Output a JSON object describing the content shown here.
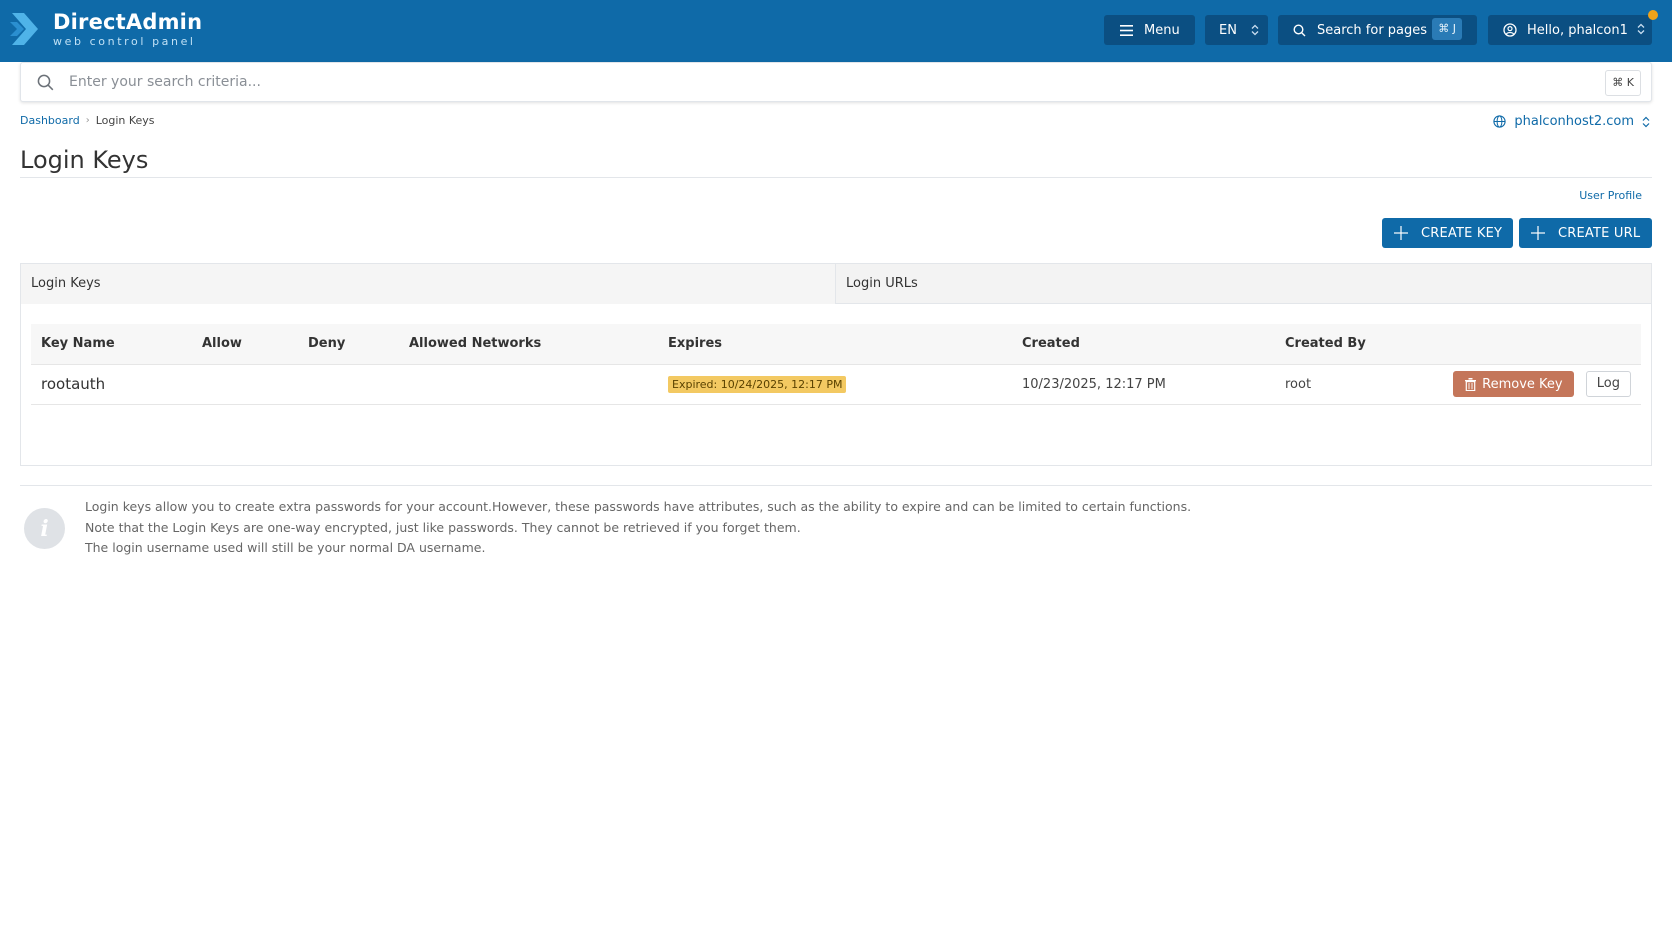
{
  "header": {
    "brand_title": "DirectAdmin",
    "brand_subtitle": "web control panel",
    "menu_label": "Menu",
    "language": "EN",
    "search_pages_label": "Search for pages",
    "search_pages_shortcut": "⌘ J",
    "user_greeting": "Hello, phalcon1",
    "brand_color": "#0f6aa8",
    "notification_color": "#f0a31a"
  },
  "search": {
    "placeholder": "Enter your search criteria...",
    "shortcut": "⌘ K"
  },
  "breadcrumb": {
    "items": [
      "Dashboard",
      "Login Keys"
    ]
  },
  "domain_selector": "phalconhost2.com",
  "page": {
    "title": "Login Keys",
    "user_profile_link": "User Profile",
    "create_key_label": "CREATE KEY",
    "create_url_label": "CREATE URL"
  },
  "tabs": [
    {
      "label": "Login Keys",
      "active": true
    },
    {
      "label": "Login URLs",
      "active": false
    }
  ],
  "table": {
    "columns": [
      "Key Name",
      "Allow",
      "Deny",
      "Allowed Networks",
      "Expires",
      "Created",
      "Created By"
    ],
    "rows": [
      {
        "key_name": "rootauth",
        "allow": "",
        "deny": "",
        "allowed_networks": "",
        "expires": "Expired: 10/24/2025, 12:17 PM",
        "created": "10/23/2025, 12:17 PM",
        "created_by": "root",
        "remove_label": "Remove Key",
        "log_label": "Log"
      }
    ]
  },
  "info": {
    "lines": [
      "Login keys allow you to create extra passwords for your account.However, these passwords have attributes, such as the ability to expire and can be limited to certain functions.",
      "Note that the Login Keys are one-way encrypted, just like passwords. They cannot be retrieved if you forget them.",
      "The login username used will still be your normal DA username."
    ]
  }
}
